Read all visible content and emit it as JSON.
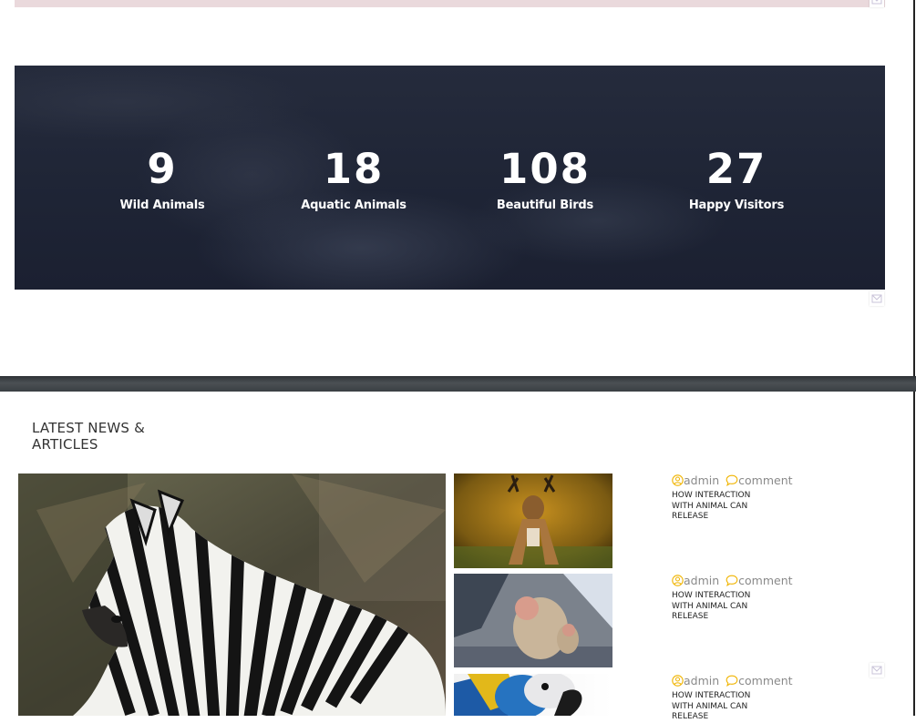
{
  "stats": [
    {
      "number": "9",
      "label": "Wild Animals"
    },
    {
      "number": "18",
      "label": "Aquatic Animals"
    },
    {
      "number": "108",
      "label": "Beautiful Birds"
    },
    {
      "number": "27",
      "label": "Happy Visitors"
    }
  ],
  "news": {
    "title": "LATEST NEWS & ARTICLES",
    "posts": [
      {
        "author": "admin",
        "comment_label": "comment",
        "title": "HOW INTERACTION WITH ANIMAL CAN RELEASE"
      },
      {
        "author": "admin",
        "comment_label": "comment",
        "title": "HOW INTERACTION WITH ANIMAL CAN RELEASE"
      },
      {
        "author": "admin",
        "comment_label": "comment",
        "title": "HOW INTERACTION WITH ANIMAL CAN RELEASE"
      }
    ]
  },
  "images": {
    "featured": "zebra-photo",
    "thumbs": [
      "deer-photo",
      "monkey-photo",
      "parrot-photo"
    ]
  },
  "colors": {
    "stats_background": "#1f2536",
    "meta_icon": "#f0b400",
    "meta_text": "#8a8a8a"
  }
}
